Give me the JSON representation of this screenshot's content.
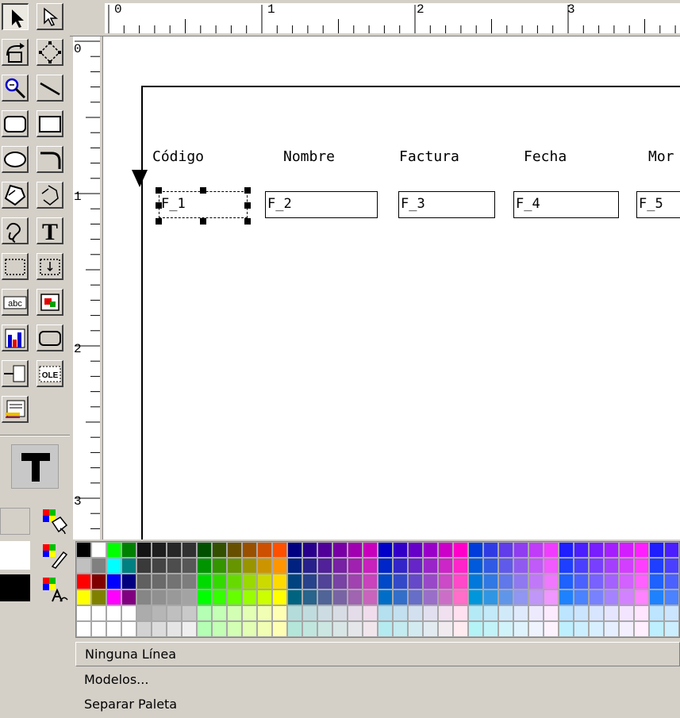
{
  "toolbox": {
    "tools": [
      {
        "name": "pointer-tool",
        "icon": "arrow-select-icon"
      },
      {
        "name": "frame-select-tool",
        "icon": "hollow-arrow-icon"
      },
      {
        "name": "rotate-tool",
        "icon": "rotate-icon"
      },
      {
        "name": "reshape-tool",
        "icon": "reshape-diamond-icon"
      },
      {
        "name": "magnify-tool",
        "icon": "magnify-icon"
      },
      {
        "name": "line-tool",
        "icon": "line-icon"
      },
      {
        "name": "rounded-rectangle-tool",
        "icon": "rounded-rectangle-icon"
      },
      {
        "name": "rectangle-tool",
        "icon": "rectangle-icon"
      },
      {
        "name": "ellipse-tool",
        "icon": "ellipse-icon"
      },
      {
        "name": "arc-tool",
        "icon": "arc-icon"
      },
      {
        "name": "polygon-tool",
        "icon": "polygon-icon"
      },
      {
        "name": "polyline-tool",
        "icon": "polyline-icon"
      },
      {
        "name": "freehand-tool",
        "icon": "freehand-icon"
      },
      {
        "name": "text-tool",
        "icon": "text-icon",
        "label": "T"
      },
      {
        "name": "frame-tool",
        "icon": "frame-icon"
      },
      {
        "name": "repeating-frame-tool",
        "icon": "repeating-frame-icon"
      },
      {
        "name": "field-tool",
        "icon": "field-icon",
        "label": "abc"
      },
      {
        "name": "image-tool",
        "icon": "image-icon"
      },
      {
        "name": "chart-tool",
        "icon": "chart-icon"
      },
      {
        "name": "button-tool",
        "icon": "button-icon"
      },
      {
        "name": "link-tool",
        "icon": "link-icon"
      },
      {
        "name": "ole-tool",
        "icon": "ole-icon",
        "label": "OLE"
      },
      {
        "name": "report-block-tool",
        "icon": "report-block-icon"
      }
    ],
    "big_text_icon": "T",
    "fill_color": "#d4d0c8",
    "line_color": "#ffffff",
    "text_color": "#000000"
  },
  "ruler": {
    "horizontal_labels": [
      "0",
      "1",
      "2",
      "3"
    ],
    "vertical_labels": [
      "0",
      "1",
      "2",
      "3"
    ]
  },
  "layout": {
    "columns": [
      "Código",
      "Nombre",
      "Factura",
      "Fecha",
      "Mor"
    ],
    "fields": [
      "F_1",
      "F_2",
      "F_3",
      "F_4",
      "F_5"
    ],
    "selected_field": "F_1"
  },
  "palette": {
    "menu": {
      "no_line": "Ninguna Línea",
      "models": "Modelos...",
      "tear_off": "Separar Paleta"
    }
  }
}
